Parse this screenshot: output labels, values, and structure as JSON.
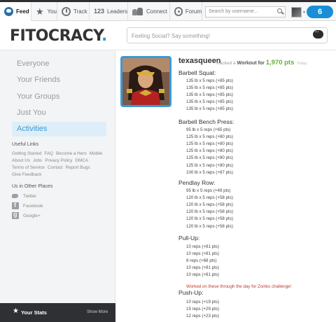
{
  "nav": {
    "tabs": [
      {
        "label": "Feed"
      },
      {
        "label": "You"
      },
      {
        "label": "Track"
      },
      {
        "label": "Leaders",
        "icon_text": "123"
      },
      {
        "label": "Connect"
      },
      {
        "label": "Forum"
      }
    ],
    "search_placeholder": "Search by username...",
    "notification_count": "6"
  },
  "header": {
    "logo_text": "FITOCRACY",
    "logo_dot": ".",
    "status_placeholder": "Feeling Social? Say something!"
  },
  "sidebar": {
    "items": [
      {
        "label": "Everyone"
      },
      {
        "label": "Your Friends"
      },
      {
        "label": "Your Groups"
      },
      {
        "label": "Just You"
      },
      {
        "label": "Activities"
      }
    ],
    "useful_links_title": "Useful Links",
    "useful_links": [
      "Getting Started",
      "FAQ",
      "Become a Hero",
      "Mobile",
      "About Us",
      "Jobs",
      "Privacy Policy",
      "DMCA",
      "Terms of Service",
      "Contact",
      "Report Bugs",
      "Give Feedback"
    ],
    "other_places_title": "Us in Other Places",
    "social": [
      "Twitter",
      "Facebook",
      "Google+"
    ],
    "stats_label": "Your Stats",
    "show_more": "Show More"
  },
  "post": {
    "username": "texasqueen",
    "tracked_prefix": "Tracked a",
    "workout_word": "Workout",
    "for_word": "for",
    "points": "1,970 pts",
    "when": "Today",
    "exercises": [
      {
        "name": "Barbell Squat:",
        "sets": [
          "135 lb x 5 reps (+85 pts)",
          "135 lb x 5 reps (+85 pts)",
          "135 lb x 5 reps (+85 pts)",
          "135 lb x 5 reps (+85 pts)",
          "135 lb x 5 reps (+85 pts)"
        ]
      },
      {
        "name": "Barbell Bench Press:",
        "sets": [
          "95 lb x 5 reps (+65 pts)",
          "125 lb x 5 reps (+80 pts)",
          "125 lb x 5 reps (+80 pts)",
          "125 lb x 5 reps (+80 pts)",
          "125 lb x 5 reps (+80 pts)",
          "125 lb x 5 reps (+80 pts)",
          "100 lb x 5 reps (+67 pts)"
        ]
      },
      {
        "name": "Pendlay Row:",
        "sets": [
          "95 lb x 5 reps (+49 pts)",
          "120 lb x 5 reps (+58 pts)",
          "120 lb x 5 reps (+58 pts)",
          "120 lb x 5 reps (+58 pts)",
          "120 lb x 5 reps (+58 pts)",
          "120 lb x 5 reps (+58 pts)"
        ]
      },
      {
        "name": "Pull-Up:",
        "sets": [
          "10 reps (+81 pts)",
          "10 reps (+81 pts)",
          "8 reps (+68 pts)",
          "10 reps (+81 pts)",
          "10 reps (+81 pts)"
        ],
        "note": "Worked on these through the day for Zoinks challenge!"
      },
      {
        "name": "Push-Up:",
        "sets": [
          "10 reps (+19 pts)",
          "15 reps (+29 pts)",
          "12 reps (+23 pts)"
        ]
      }
    ]
  },
  "colors": {
    "accent_blue": "#3a9ad6",
    "points_green": "#62b22f",
    "note_red": "#c0392b",
    "notification_blue": "#1a8fd8"
  }
}
